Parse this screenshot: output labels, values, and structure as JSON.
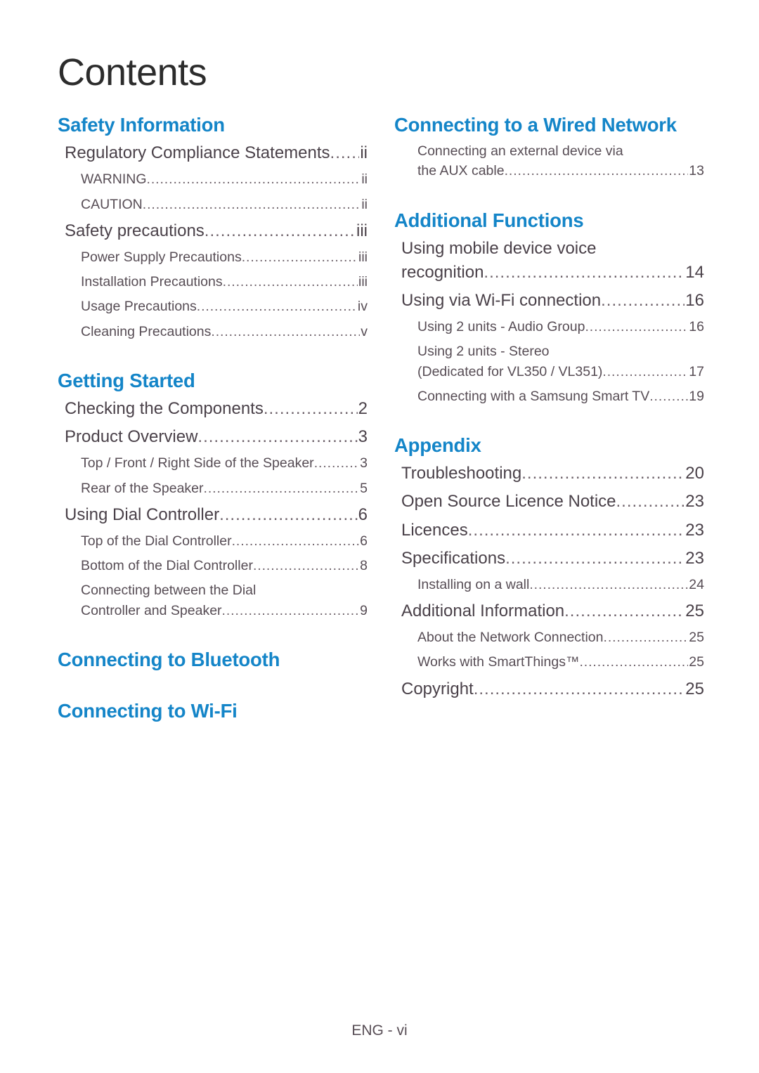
{
  "document": {
    "title": "Contents",
    "footer": "ENG - vi",
    "accent_color": "#1485C8",
    "text_color": "#3A3238",
    "background": "#FFFFFF"
  },
  "left_column": {
    "sections": [
      {
        "heading": "Safety Information",
        "entries": [
          {
            "level": 1,
            "label": "Regulatory Compliance Statements",
            "page": "ii"
          },
          {
            "level": 2,
            "label": "WARNING",
            "page": "ii"
          },
          {
            "level": 2,
            "label": "CAUTION",
            "page": "ii"
          },
          {
            "level": 1,
            "label": "Safety precautions",
            "page": "iii"
          },
          {
            "level": 2,
            "label": "Power Supply Precautions",
            "page": "iii"
          },
          {
            "level": 2,
            "label": "Installation Precautions",
            "page": "iii"
          },
          {
            "level": 2,
            "label": "Usage Precautions",
            "page": "iv"
          },
          {
            "level": 2,
            "label": "Cleaning Precautions",
            "page": "v"
          }
        ]
      },
      {
        "heading": "Getting Started",
        "entries": [
          {
            "level": 1,
            "label": "Checking the Components",
            "page": "2"
          },
          {
            "level": 1,
            "label": "Product Overview",
            "page": "3"
          },
          {
            "level": 2,
            "label": "Top / Front / Right Side of the Speaker",
            "page": "3"
          },
          {
            "level": 2,
            "label": "Rear of the Speaker",
            "page": "5"
          },
          {
            "level": 1,
            "label": "Using Dial Controller",
            "page": "6"
          },
          {
            "level": 2,
            "label": "Top of the Dial Controller",
            "page": "6"
          },
          {
            "level": 2,
            "label": "Bottom of the Dial Controller",
            "page": "8"
          },
          {
            "level": 2,
            "label": "Connecting between the Dial Controller and Speaker",
            "page": "9",
            "wrap_first": "Connecting between the Dial",
            "wrap_last": "Controller and Speaker"
          }
        ]
      },
      {
        "heading": "Connecting to Bluetooth",
        "entries": []
      },
      {
        "heading": "Connecting to Wi-Fi",
        "entries": []
      }
    ]
  },
  "right_column": {
    "sections": [
      {
        "heading": "Connecting to a Wired Network",
        "entries": [
          {
            "level": 2,
            "label": "Connecting an external device via the AUX cable",
            "page": "13",
            "wrap_first": "Connecting an external device via",
            "wrap_last": "the AUX cable"
          }
        ]
      },
      {
        "heading": "Additional Functions",
        "entries": [
          {
            "level": 1,
            "label": "Using mobile device voice recognition",
            "page": "14",
            "wrap_first": "Using mobile device voice",
            "wrap_last": "recognition"
          },
          {
            "level": 1,
            "label": "Using via Wi-Fi connection",
            "page": "16"
          },
          {
            "level": 2,
            "label": "Using 2 units - Audio Group",
            "page": "16"
          },
          {
            "level": 2,
            "label": "Using 2 units - Stereo (Dedicated for VL350 / VL351)",
            "page": "17",
            "wrap_first": "Using 2 units - Stereo",
            "wrap_last": "(Dedicated for VL350 / VL351)"
          },
          {
            "level": 2,
            "label": "Connecting with a Samsung Smart TV",
            "page": "19"
          }
        ]
      },
      {
        "heading": "Appendix",
        "entries": [
          {
            "level": 1,
            "label": "Troubleshooting",
            "page": "20"
          },
          {
            "level": 1,
            "label": "Open Source Licence Notice",
            "page": "23"
          },
          {
            "level": 1,
            "label": "Licences",
            "page": "23"
          },
          {
            "level": 1,
            "label": "Specifications",
            "page": "23"
          },
          {
            "level": 2,
            "label": "Installing on a wall",
            "page": "24"
          },
          {
            "level": 1,
            "label": "Additional Information",
            "page": "25"
          },
          {
            "level": 2,
            "label": "About the Network Connection",
            "page": "25"
          },
          {
            "level": 2,
            "label": "Works with SmartThings™",
            "page": "25"
          },
          {
            "level": 1,
            "label": "Copyright",
            "page": "25"
          }
        ]
      }
    ]
  }
}
